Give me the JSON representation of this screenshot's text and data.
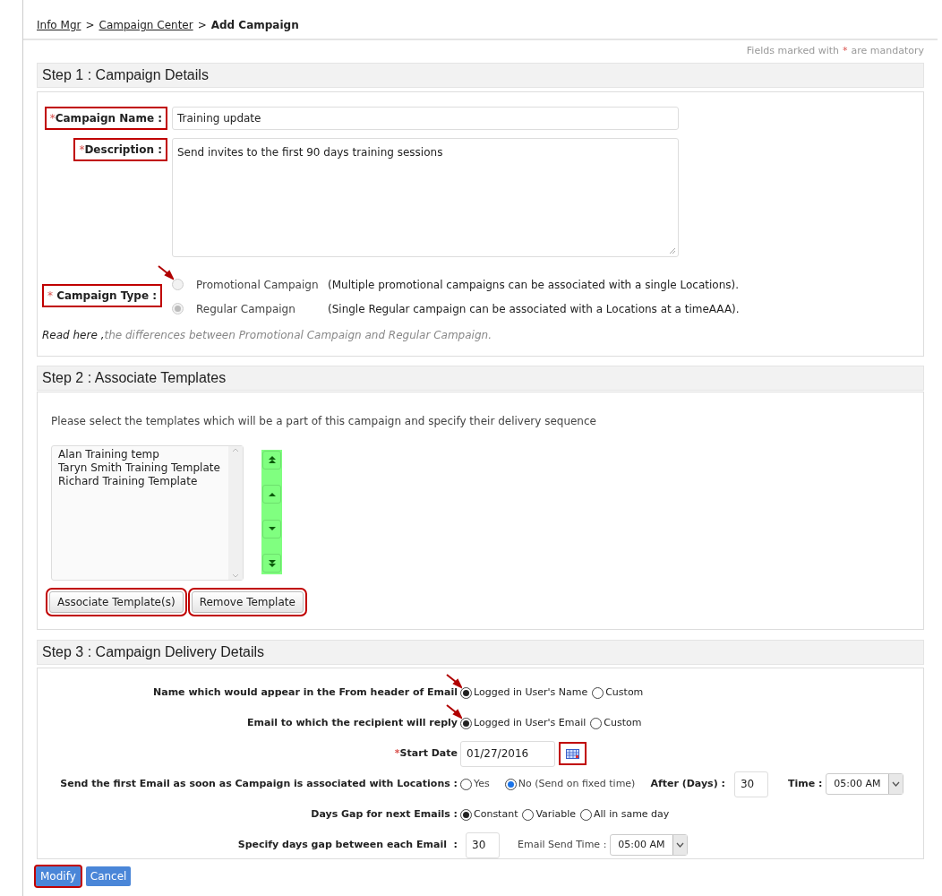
{
  "breadcrumb": [
    {
      "label": "Info Mgr",
      "link": true
    },
    {
      "label": ">",
      "link": false
    },
    {
      "label": "Campaign Center",
      "link": true
    },
    {
      "label": ">",
      "link": false
    },
    {
      "label": "Add Campaign",
      "link": false
    }
  ],
  "mandatory_note": {
    "before": "Fields marked with",
    "mark": "*",
    "after": "are mandatory"
  },
  "step1": {
    "title": "Step 1 : Campaign Details",
    "name": {
      "mark": "*",
      "label": "Campaign Name :",
      "highlighted": true,
      "value": "Training update"
    },
    "description": {
      "mark": "*",
      "label": "Description :",
      "highlighted": true,
      "value": "Send invites to the first 90 days training sessions"
    },
    "type": {
      "mark": "*",
      "label": "Campaign Type :",
      "highlighted": true,
      "options": [
        {
          "label": "Promotional Campaign",
          "note": "(Multiple promotional campaigns can be associated with a single Locations).",
          "selected": false,
          "disabled": true,
          "pointed": true
        },
        {
          "label": "Regular Campaign",
          "note": "(Single Regular campaign can be associated with a Locations at a timeAAA).",
          "selected": true,
          "disabled": true,
          "pointed": false
        }
      ]
    },
    "read_here": {
      "lead": "Read here ,",
      "text": "the differences between Promotional Campaign and Regular Campaign."
    }
  },
  "step2": {
    "title": "Step 2 : Associate Templates",
    "instruction": "Please select the templates which will be a part of this campaign and specify their delivery sequence",
    "templates": [
      "Alan Training temp",
      "Taryn Smith Training Template",
      "Richard Training Template"
    ],
    "order_buttons": [
      {
        "kind": "top"
      },
      {
        "kind": "up"
      },
      {
        "kind": "down"
      },
      {
        "kind": "bottom"
      }
    ],
    "buttons": [
      {
        "label": "Associate Template(s)",
        "highlighted": true
      },
      {
        "label": "Remove Template",
        "highlighted": true
      }
    ]
  },
  "step3": {
    "title": "Step 3 : Campaign Delivery Details",
    "rows": [
      {
        "mark": "",
        "label": "Name which would appear in the From header of Email",
        "controls": [
          {
            "kind": "radio",
            "label": "Logged in User's Name",
            "selected": true,
            "pointed": true
          },
          {
            "kind": "radio",
            "label": "Custom",
            "selected": false,
            "pointed": false
          }
        ]
      },
      {
        "mark": "",
        "label": "Email to which the recipient will reply",
        "controls": [
          {
            "kind": "radio",
            "label": "Logged in User's Email",
            "selected": true,
            "pointed": true
          },
          {
            "kind": "radio",
            "label": "Custom",
            "selected": false,
            "pointed": false
          }
        ]
      },
      {
        "mark": "*",
        "label": "Start Date",
        "controls": [
          {
            "kind": "input",
            "value": "01/27/2016",
            "wide": true
          },
          {
            "kind": "calendar",
            "highlighted": true
          }
        ]
      },
      {
        "mark": "",
        "label": "Send the first Email as soon as Campaign is associated with Locations :",
        "controls": [
          {
            "kind": "radio",
            "label": "Yes",
            "selected": false,
            "pointed": false
          },
          {
            "kind": "radio",
            "label": "No (Send on fixed time)",
            "selected": true,
            "pointed": false
          },
          {
            "kind": "text",
            "label": "After (Days) :",
            "bold": true
          },
          {
            "kind": "input",
            "value": "30",
            "wide": false
          },
          {
            "kind": "text",
            "label": "Time :",
            "bold": true
          },
          {
            "kind": "select",
            "value": "05:00 AM"
          }
        ]
      },
      {
        "mark": "",
        "label": "Days Gap for next Emails :",
        "controls": [
          {
            "kind": "radio",
            "label": "Constant",
            "selected": true,
            "pointed": false
          },
          {
            "kind": "radio",
            "label": "Variable",
            "selected": false,
            "pointed": false
          },
          {
            "kind": "radio",
            "label": "All in same day",
            "selected": false,
            "pointed": false
          }
        ]
      },
      {
        "mark": "",
        "label": "Specify days gap between each Email  :",
        "controls": [
          {
            "kind": "input",
            "value": "30",
            "wide": false
          },
          {
            "kind": "text",
            "label": "Email Send Time :",
            "bold": false
          },
          {
            "kind": "select",
            "value": "05:00 AM"
          }
        ]
      }
    ]
  },
  "actions": [
    {
      "label": "Modify",
      "highlighted": true
    },
    {
      "label": "Cancel",
      "highlighted": false
    }
  ]
}
